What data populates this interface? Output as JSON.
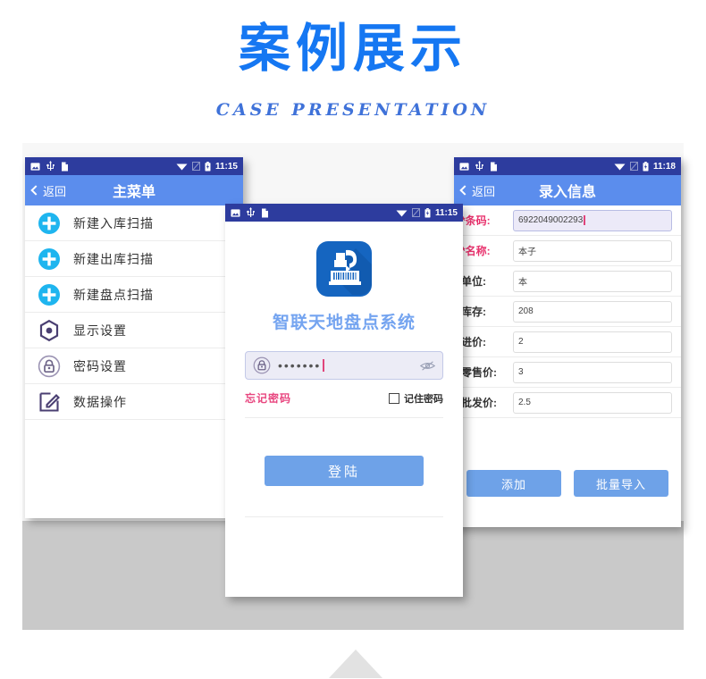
{
  "header": {
    "title": "案例展示",
    "subtitle": "CASE  PRESENTATION"
  },
  "colors": {
    "accent_blue": "#1577f2",
    "appbar_blue": "#5b8ded",
    "statusbar_blue": "#2d3c9e",
    "button_blue": "#6ea2e8",
    "required_red": "#e8326d",
    "stage_gray": "#c9c9c9"
  },
  "phone_menu": {
    "statusbar": {
      "icons": [
        "image-icon",
        "usb-icon",
        "document-icon",
        "wifi-icon",
        "signal-icon",
        "battery-icon"
      ],
      "time": "11:15"
    },
    "appbar": {
      "back_label": "返回",
      "title": "主菜单"
    },
    "items": [
      {
        "icon": "plus-circle-icon",
        "label": "新建入库扫描"
      },
      {
        "icon": "plus-circle-icon",
        "label": "新建出库扫描"
      },
      {
        "icon": "plus-circle-icon",
        "label": "新建盘点扫描"
      },
      {
        "icon": "hexagon-settings-icon",
        "label": "显示设置"
      },
      {
        "icon": "lock-circle-icon",
        "label": "密码设置"
      },
      {
        "icon": "pencil-square-icon",
        "label": "数据操作"
      }
    ]
  },
  "phone_login": {
    "statusbar": {
      "icons": [
        "image-icon",
        "usb-icon",
        "document-icon",
        "wifi-icon",
        "signal-icon",
        "battery-icon"
      ],
      "time": "11:15"
    },
    "logo": "barcode-scanner-app-icon",
    "app_name": "智联天地盘点系统",
    "password": {
      "icon": "lock-icon",
      "value": "•••••••",
      "toggle_icon": "eye-slash-icon"
    },
    "forgot_label": "忘记密码",
    "remember_label": "记住密码",
    "remember_checked": false,
    "login_button": "登陆"
  },
  "phone_form": {
    "statusbar": {
      "icons": [
        "image-icon",
        "usb-icon",
        "document-icon",
        "wifi-icon",
        "signal-icon",
        "battery-icon"
      ],
      "time": "11:18"
    },
    "appbar": {
      "back_label": "返回",
      "title": "录入信息"
    },
    "fields": [
      {
        "label": "条码:",
        "required": true,
        "value": "6922049002293",
        "focused": true
      },
      {
        "label": "名称:",
        "required": true,
        "value": "本子",
        "focused": false
      },
      {
        "label": "单位:",
        "required": false,
        "value": "本",
        "focused": false
      },
      {
        "label": "库存:",
        "required": false,
        "value": "208",
        "focused": false
      },
      {
        "label": "进价:",
        "required": false,
        "value": "2",
        "focused": false
      },
      {
        "label": "零售价:",
        "required": false,
        "value": "3",
        "focused": false
      },
      {
        "label": "批发价:",
        "required": false,
        "value": "2.5",
        "focused": false
      }
    ],
    "buttons": {
      "add": "添加",
      "batch_import": "批量导入"
    }
  }
}
